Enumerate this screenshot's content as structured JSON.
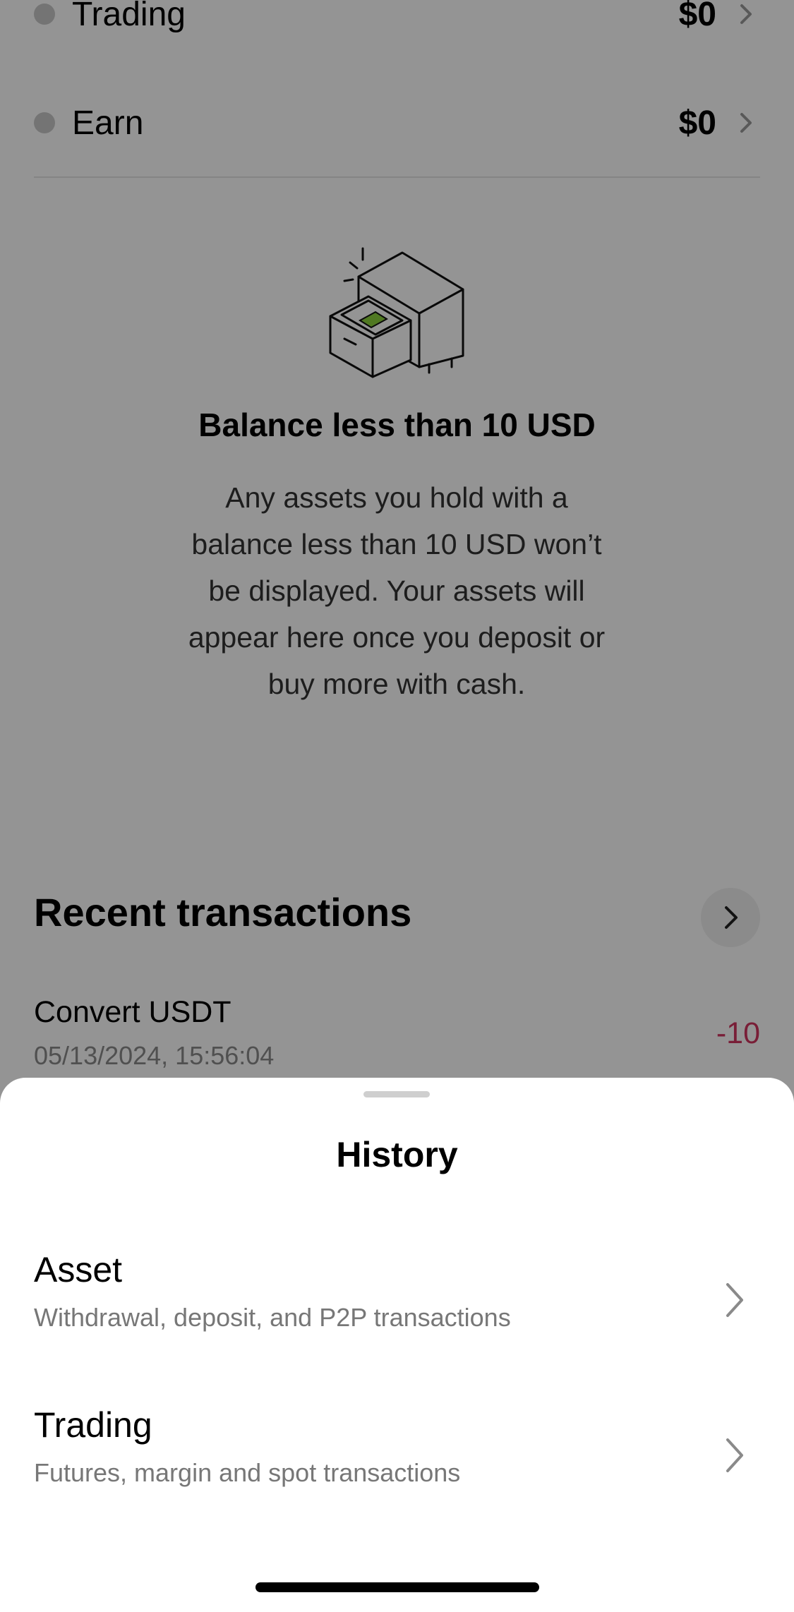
{
  "accounts": [
    {
      "label": "Trading",
      "value": "$0"
    },
    {
      "label": "Earn",
      "value": "$0"
    }
  ],
  "empty_state": {
    "title": "Balance less than 10 USD",
    "body": "Any assets you hold with a balance less than 10 USD won’t be displayed. Your assets will appear here once you deposit or buy more with cash."
  },
  "recent": {
    "title": "Recent transactions",
    "items": [
      {
        "title": "Convert USDT",
        "date": "05/13/2024, 15:56:04",
        "amount": "-10"
      }
    ]
  },
  "sheet": {
    "title": "History",
    "options": [
      {
        "title": "Asset",
        "subtitle": "Withdrawal, deposit, and P2P transactions"
      },
      {
        "title": "Trading",
        "subtitle": "Futures, margin and spot transactions"
      }
    ]
  },
  "colors": {
    "negative_amount": "#d0355f",
    "overlay": "rgba(0,0,0,0.42)",
    "illustration_accent": "#8bd03c"
  }
}
